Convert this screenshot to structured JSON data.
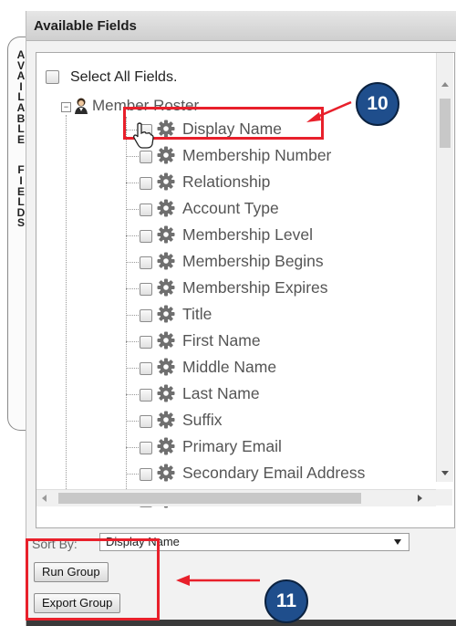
{
  "panel": {
    "title": "Available Fields",
    "side_tab_letters": [
      "A",
      "V",
      "A",
      "I",
      "L",
      "A",
      "B",
      "L",
      "E",
      "",
      "F",
      "I",
      "E",
      "L",
      "D",
      "S"
    ]
  },
  "tree": {
    "select_all_label": "Select All Fields.",
    "root_label": "Member Roster",
    "items": [
      {
        "label": "Display Name"
      },
      {
        "label": "Membership Number"
      },
      {
        "label": "Relationship"
      },
      {
        "label": "Account Type"
      },
      {
        "label": "Membership Level"
      },
      {
        "label": "Membership Begins"
      },
      {
        "label": "Membership Expires"
      },
      {
        "label": "Title"
      },
      {
        "label": "First Name"
      },
      {
        "label": "Middle Name"
      },
      {
        "label": "Last Name"
      },
      {
        "label": "Suffix"
      },
      {
        "label": "Primary Email"
      },
      {
        "label": "Secondary Email Address"
      },
      {
        "label": "Third Email Address"
      }
    ]
  },
  "sort": {
    "label": "Sort By:",
    "value": "Display Name"
  },
  "buttons": {
    "run_group": "Run Group",
    "export_group": "Export Group"
  },
  "annotations": {
    "badge_10": "10",
    "badge_11": "11",
    "highlight_color": "#e8202b",
    "badge_color": "#1f4e8c"
  }
}
